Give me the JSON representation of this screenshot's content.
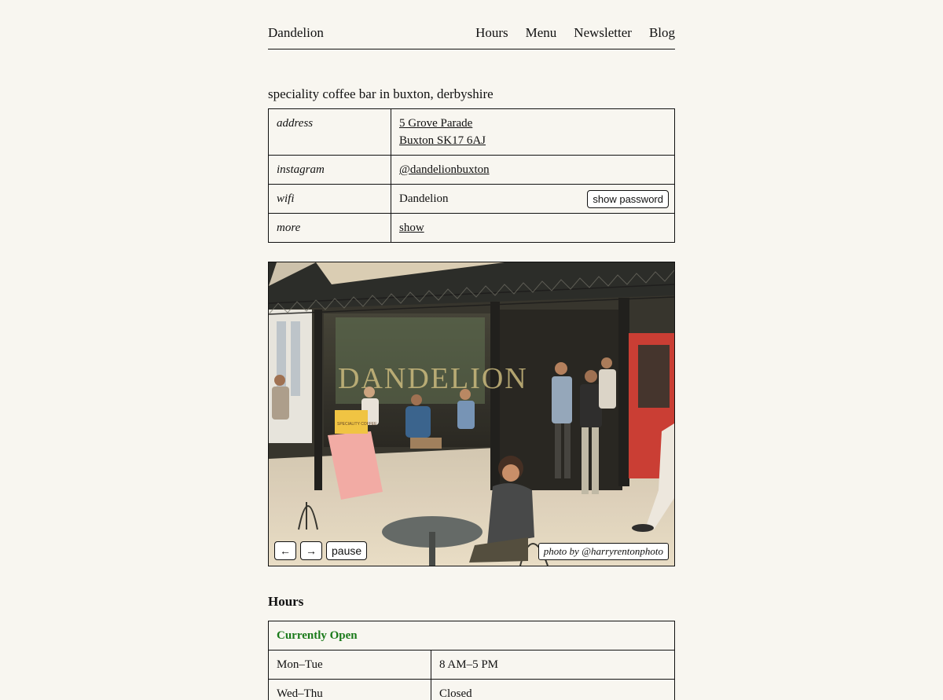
{
  "nav": {
    "brand": "Dandelion",
    "links": [
      "Hours",
      "Menu",
      "Newsletter",
      "Blog"
    ]
  },
  "tagline": "speciality coffee bar in buxton, derbyshire",
  "info": {
    "address_label": "address",
    "address_line1": "5 Grove Parade",
    "address_line2": "Buxton SK17 6AJ",
    "instagram_label": "instagram",
    "instagram_handle": "@dandelionbuxton",
    "wifi_label": "wifi",
    "wifi_name": "Dandelion",
    "wifi_button": "show password",
    "more_label": "more",
    "more_link": "show"
  },
  "photo": {
    "prev": "←",
    "next": "→",
    "pause": "pause",
    "credit": "photo by @harryrentonphoto",
    "window_lettering": "DANDELION",
    "sign_lettering": "SPECIALITY COFFEE"
  },
  "hours": {
    "heading": "Hours",
    "status": "Currently Open",
    "status_color": "#1a7a1a",
    "rows": [
      {
        "day": "Mon–Tue",
        "time": "8 AM–5 PM"
      },
      {
        "day": "Wed–Thu",
        "time": "Closed"
      }
    ]
  }
}
